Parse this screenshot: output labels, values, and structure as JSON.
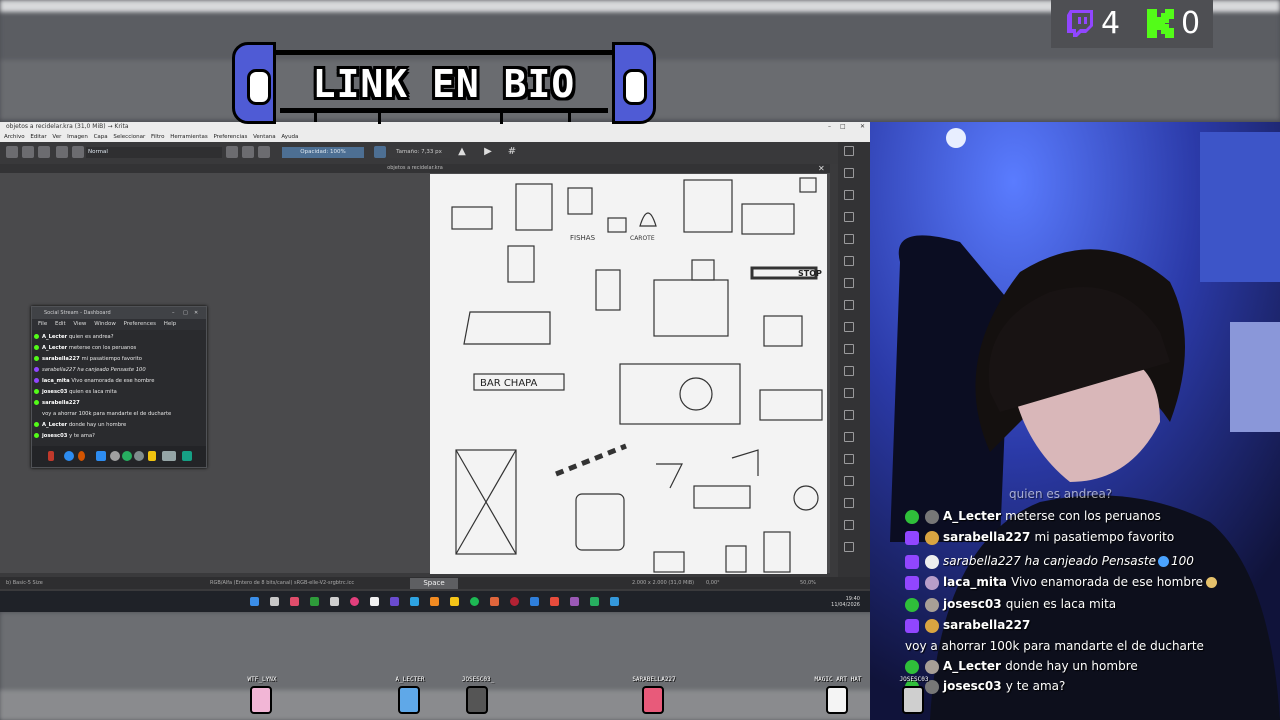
{
  "banner": {
    "text": "LINK EN BIO"
  },
  "counters": {
    "twitch": "4",
    "kick": "0",
    "twitch_color": "#9146ff",
    "kick_color": "#53fc18"
  },
  "krita": {
    "window_title": "objetos a recidelar.kra (31,0 MiB) → Krita",
    "menu": [
      "Archivo",
      "Editar",
      "Ver",
      "Imagen",
      "Capa",
      "Seleccionar",
      "Filtro",
      "Herramientas",
      "Preferencias",
      "Ventana",
      "Ayuda"
    ],
    "blend_mode": "Normal",
    "opacity": "Opacidad: 100%",
    "size": "Tamaño: 7,33 px",
    "doc_tab": "objetos a recidelar.kra",
    "status_left": "b) Basic-5 Size",
    "status_mid": "RGB/Alfa (Entero de 8 bits/canal)  sRGB-elle-V2-srgbtrc.icc",
    "status_right": "2.000 x 2.000 (31,0 MiB)",
    "status_angle": "0,00°",
    "status_zoom": "50,0%",
    "space_key": "Space",
    "clock_time": "19:40",
    "clock_date": "11/04/2026",
    "canvas_labels": {
      "fishas": "FISHAS",
      "carote": "CAROTE",
      "bar_chapa": "BAR CHAPA",
      "stop": "STOP"
    }
  },
  "social": {
    "title": "Social Stream - Dashboard",
    "menu": [
      "File",
      "Edit",
      "View",
      "Window",
      "Preferences",
      "Help"
    ],
    "messages": [
      {
        "user": "A_Lecter",
        "text": "quien es andrea?",
        "platform": "kick"
      },
      {
        "user": "A_Lecter",
        "text": "meterse con los peruanos",
        "platform": "kick"
      },
      {
        "user": "sarabella227",
        "text": "mi pasatiempo favorito",
        "platform": "kick"
      },
      {
        "user": "",
        "text": "sarabella227 ha canjeado Pensaste 100",
        "platform": "twitch"
      },
      {
        "user": "laca_mita",
        "text": "Vivo enamorada de ese hombre",
        "platform": "twitch"
      },
      {
        "user": "josesc03",
        "text": "quien es laca mita",
        "platform": "kick"
      },
      {
        "user": "sarabella227",
        "text": "",
        "platform": "kick"
      },
      {
        "user": "",
        "text": "voy a ahorrar 100k para mandarte el de ducharte",
        "platform": "none"
      },
      {
        "user": "A_Lecter",
        "text": "donde hay un hombre",
        "platform": "kick"
      },
      {
        "user": "josesc03",
        "text": "y te ama?",
        "platform": "kick"
      }
    ]
  },
  "chat": {
    "partial_top": "quien es andrea?",
    "messages": [
      {
        "user": "A_Lecter",
        "text": "meterse con los peruanos",
        "platform": "kick"
      },
      {
        "user": "sarabella227",
        "text": "mi pasatiempo favorito",
        "platform": "twitch"
      },
      {
        "user": "",
        "text": "sarabella227 ha canjeado Pensaste",
        "suffix": "100",
        "platform": "twitch",
        "italic": true
      },
      {
        "user": "laca_mita",
        "text": "Vivo enamorada de ese hombre",
        "platform": "twitch"
      },
      {
        "user": "josesc03",
        "text": "quien es laca mita",
        "platform": "kick"
      },
      {
        "user": "sarabella227",
        "text": "",
        "platform": "twitch"
      },
      {
        "user": "",
        "text": "voy a ahorrar 100k para mandarte el de ducharte",
        "platform": "none"
      },
      {
        "user": "A_Lecter",
        "text": "donde hay un hombre",
        "platform": "kick"
      },
      {
        "user": "josesc03",
        "text": "y te ama?",
        "platform": "kick"
      }
    ]
  },
  "characters": [
    {
      "name": "WTF_LYNX"
    },
    {
      "name": "A_LECTER"
    },
    {
      "name": "JOSESC03_"
    },
    {
      "name": "SARABELLA227"
    },
    {
      "name": "MAGIC ART HAT"
    },
    {
      "name": "JOSESC03"
    }
  ]
}
